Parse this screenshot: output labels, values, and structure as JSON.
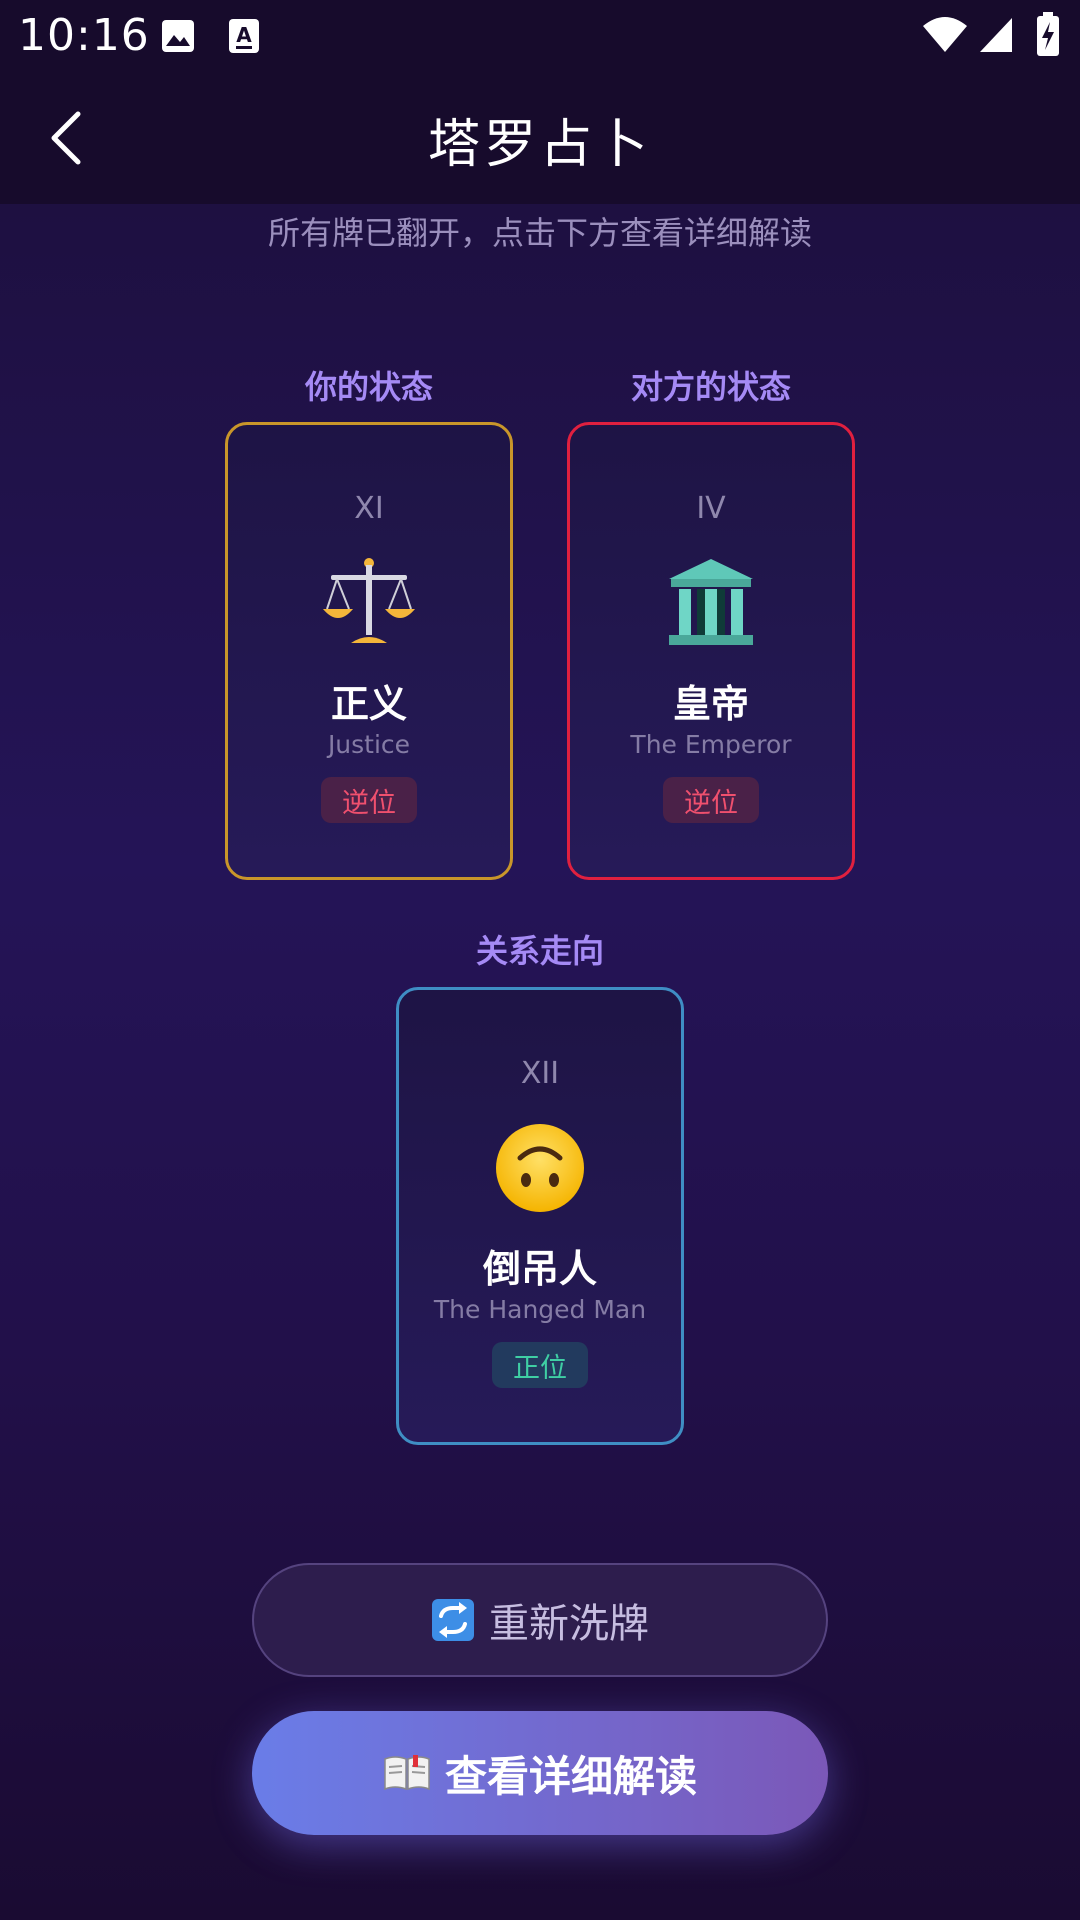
{
  "status_bar": {
    "time": "10:16",
    "icons": [
      "image-icon",
      "text-notification-icon",
      "wifi-icon",
      "signal-icon",
      "battery-charging-icon"
    ]
  },
  "header": {
    "title": "塔罗占卜",
    "back_icon": "chevron-left-icon"
  },
  "hint": "所有牌已翻开，点击下方查看详细解读",
  "colors": {
    "card1_border": "#c9962a",
    "card2_border": "#e0203f",
    "card3_border": "#3f8ec4",
    "label_color": "#a58af5"
  },
  "cards": [
    {
      "position_label": "你的状态",
      "numeral": "XI",
      "icon": "scales-emoji",
      "name": "正义",
      "name_en": "Justice",
      "orientation": "逆位"
    },
    {
      "position_label": "对方的状态",
      "numeral": "IV",
      "icon": "classical-building-emoji",
      "name": "皇帝",
      "name_en": "The Emperor",
      "orientation": "逆位"
    },
    {
      "position_label": "关系走向",
      "numeral": "XII",
      "icon": "upside-down-face-emoji",
      "name": "倒吊人",
      "name_en": "The Hanged Man",
      "orientation": "正位"
    }
  ],
  "buttons": {
    "reshuffle_label": "重新洗牌",
    "reshuffle_icon": "repeat-arrows-icon",
    "detail_label": "查看详细解读",
    "detail_icon": "open-book-icon"
  }
}
